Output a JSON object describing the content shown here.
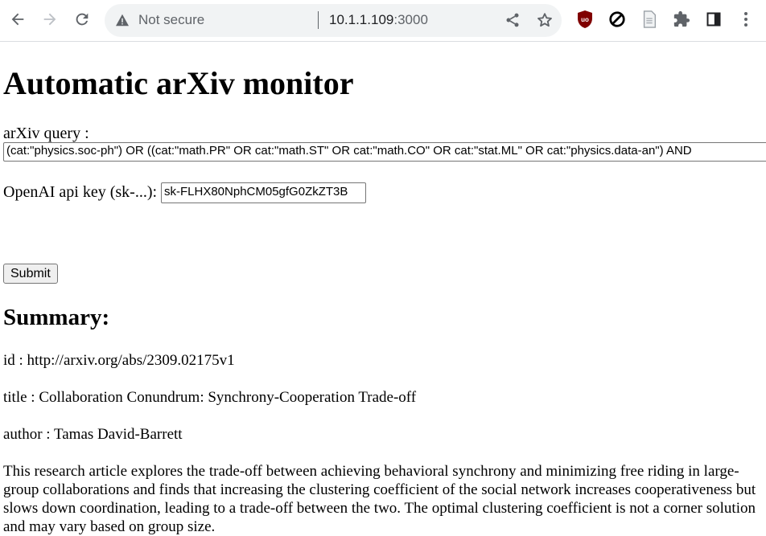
{
  "browser": {
    "security_label": "Not secure",
    "url_host": "10.1.1.109",
    "url_port": ":3000",
    "extensions": [
      "ublock-origin-icon",
      "block-icon",
      "document-icon",
      "puzzle-extensions-icon",
      "side-panel-icon"
    ]
  },
  "page": {
    "title": "Automatic arXiv monitor",
    "query_label": "arXiv query :",
    "query_value": "(cat:\"physics.soc-ph\") OR ((cat:\"math.PR\" OR cat:\"math.ST\" OR cat:\"math.CO\" OR cat:\"stat.ML\" OR cat:\"physics.data-an\") AND",
    "api_key_label": "OpenAI api key (sk-...):",
    "api_key_value": "sk-FLHX80NphCM05gfG0ZkZT3B",
    "submit_label": "Submit",
    "summary_heading": "Summary:",
    "id_text": "id : http://arxiv.org/abs/2309.02175v1",
    "title_text": "title : Collaboration Conundrum: Synchrony-Cooperation Trade-off",
    "author_text": "author : Tamas David-Barrett",
    "abstract_text": "This research article explores the trade-off between achieving behavioral synchrony and minimizing free riding in large-group collaborations and finds that increasing the clustering coefficient of the social network increases cooperativeness but slows down coordination, leading to a trade-off between the two. The optimal clustering coefficient is not a corner solution and may vary based on group size."
  }
}
